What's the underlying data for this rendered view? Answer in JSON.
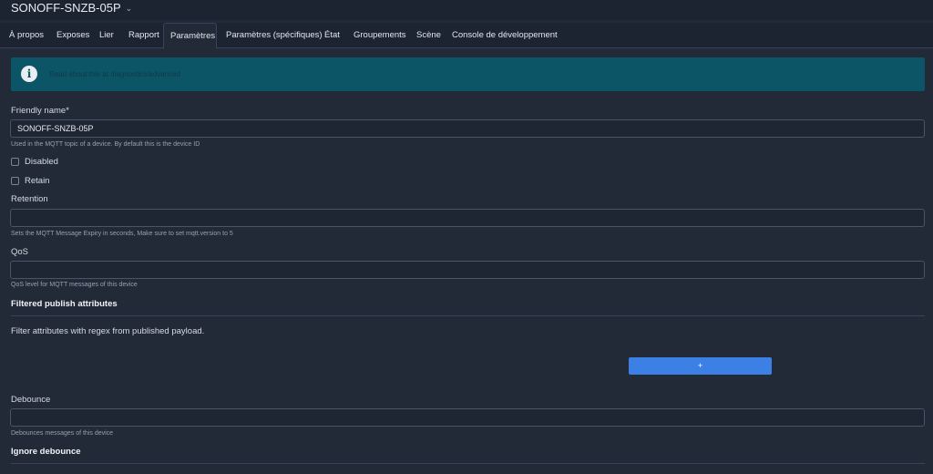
{
  "header": {
    "device_name": "SONOFF-SNZB-05P"
  },
  "tabs": [
    {
      "label": "À propos"
    },
    {
      "label": "Exposes"
    },
    {
      "label": "Lier"
    },
    {
      "label": "Rapport"
    },
    {
      "label": "Paramètres",
      "active": true
    },
    {
      "label": "Paramètres (spécifiques)"
    },
    {
      "label": "État"
    },
    {
      "label": "Groupements"
    },
    {
      "label": "Scène"
    },
    {
      "label": "Console de développement"
    }
  ],
  "alert": {
    "icon": "info-icon",
    "text": "Read about this at diagnostics/advanced"
  },
  "form": {
    "friendly_name": {
      "label": "Friendly name*",
      "value": "SONOFF-SNZB-05P",
      "help": "Used in the MQTT topic of a device. By default this is the device ID"
    },
    "disabled": {
      "label": "Disabled",
      "checked": false
    },
    "retain": {
      "label": "Retain",
      "checked": false
    },
    "retention": {
      "label": "Retention",
      "value": "",
      "help": "Sets the MQTT Message Expiry in seconds, Make sure to set mqtt.version to 5"
    },
    "qos": {
      "label": "QoS",
      "value": "",
      "help": "QoS level for MQTT messages of this device"
    },
    "filtered_publish": {
      "title": "Filtered publish attributes",
      "description": "Filter attributes with regex from published payload.",
      "add_label": "+"
    },
    "debounce": {
      "label": "Debounce",
      "value": "",
      "help": "Debounces messages of this device"
    },
    "ignore_debounce": {
      "title": "Ignore debounce"
    }
  },
  "colors": {
    "background": "#222a38",
    "alert": "#0b5567",
    "accent_button": "#3c80e6"
  }
}
